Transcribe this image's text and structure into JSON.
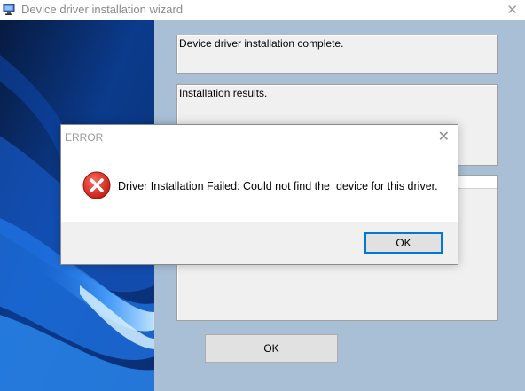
{
  "window": {
    "title": "Device driver installation wizard",
    "icon": "computer-icon",
    "close_glyph": "✕"
  },
  "main": {
    "complete_text": "Device driver installation complete.",
    "results_label": "Installation results.",
    "ok_label": "OK"
  },
  "dialog": {
    "title": "ERROR",
    "close_glyph": "✕",
    "icon": "error-icon",
    "message": "Driver Installation Failed: Could not find the  device for this driver.",
    "ok_label": "OK"
  },
  "colors": {
    "client_background": "#a8bfd6",
    "error_red": "#e0322c",
    "focus_blue": "#0078d7"
  }
}
